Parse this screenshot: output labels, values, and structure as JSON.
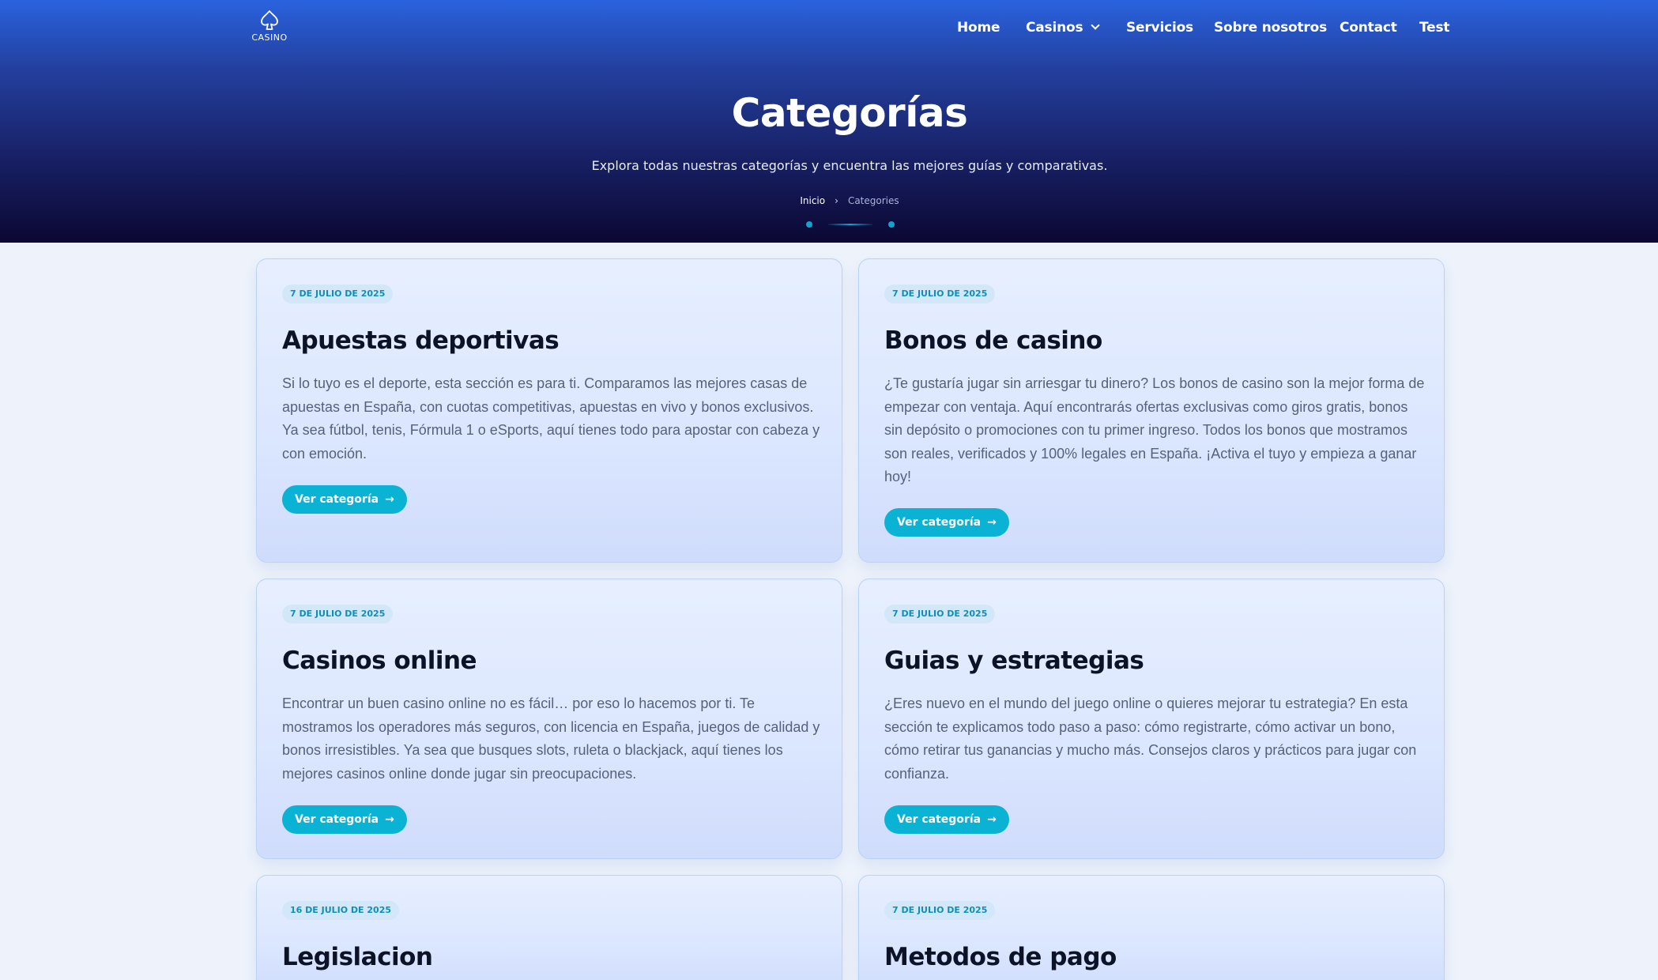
{
  "logo": {
    "text": "CASINO",
    "icon": "spade-icon"
  },
  "nav": {
    "items": [
      "Home",
      "Casinos",
      "Servicios",
      "Sobre nosotros",
      "Contact",
      "Test"
    ]
  },
  "hero": {
    "title": "Categorías",
    "subtitle": "Explora todas nuestras categorías y encuentra las mejores guías y comparativas.",
    "breadcrumb": {
      "home": "Inicio",
      "separator": "›",
      "current": "Categories"
    }
  },
  "cards": [
    {
      "date": "7 DE JULIO DE 2025",
      "title": "Apuestas deportivas",
      "text": "Si lo tuyo es el deporte, esta sección es para ti. Comparamos las mejores casas de apuestas en España, con cuotas competitivas, apuestas en vivo y bonos exclusivos. Ya sea fútbol, tenis, Fórmula 1 o eSports, aquí tienes todo para apostar con cabeza y con emoción.",
      "button": "Ver categoría",
      "arrow": "→"
    },
    {
      "date": "7 DE JULIO DE 2025",
      "title": "Bonos de casino",
      "text": "¿Te gustaría jugar sin arriesgar tu dinero? Los bonos de casino son la mejor forma de empezar con ventaja. Aquí encontrarás ofertas exclusivas como giros gratis, bonos sin depósito o promociones con tu primer ingreso. Todos los bonos que mostramos son reales, verificados y 100% legales en España. ¡Activa el tuyo y empieza a ganar hoy!",
      "button": "Ver categoría",
      "arrow": "→"
    },
    {
      "date": "7 DE JULIO DE 2025",
      "title": "Casinos online",
      "text": "Encontrar un buen casino online no es fácil… por eso lo hacemos por ti. Te mostramos los operadores más seguros, con licencia en España, juegos de calidad y bonos irresistibles. Ya sea que busques slots, ruleta o blackjack, aquí tienes los mejores casinos online donde jugar sin preocupaciones.",
      "button": "Ver categoría",
      "arrow": "→"
    },
    {
      "date": "7 DE JULIO DE 2025",
      "title": "Guias y estrategias",
      "text": "¿Eres nuevo en el mundo del juego online o quieres mejorar tu estrategia? En esta sección te explicamos todo paso a paso: cómo registrarte, cómo activar un bono, cómo retirar tus ganancias y mucho más. Consejos claros y prácticos para jugar con confianza.",
      "button": "Ver categoría",
      "arrow": "→"
    },
    {
      "date": "16 DE JULIO DE 2025",
      "title": "Legislacion"
    },
    {
      "date": "7 DE JULIO DE 2025",
      "title": "Metodos de pago"
    }
  ]
}
